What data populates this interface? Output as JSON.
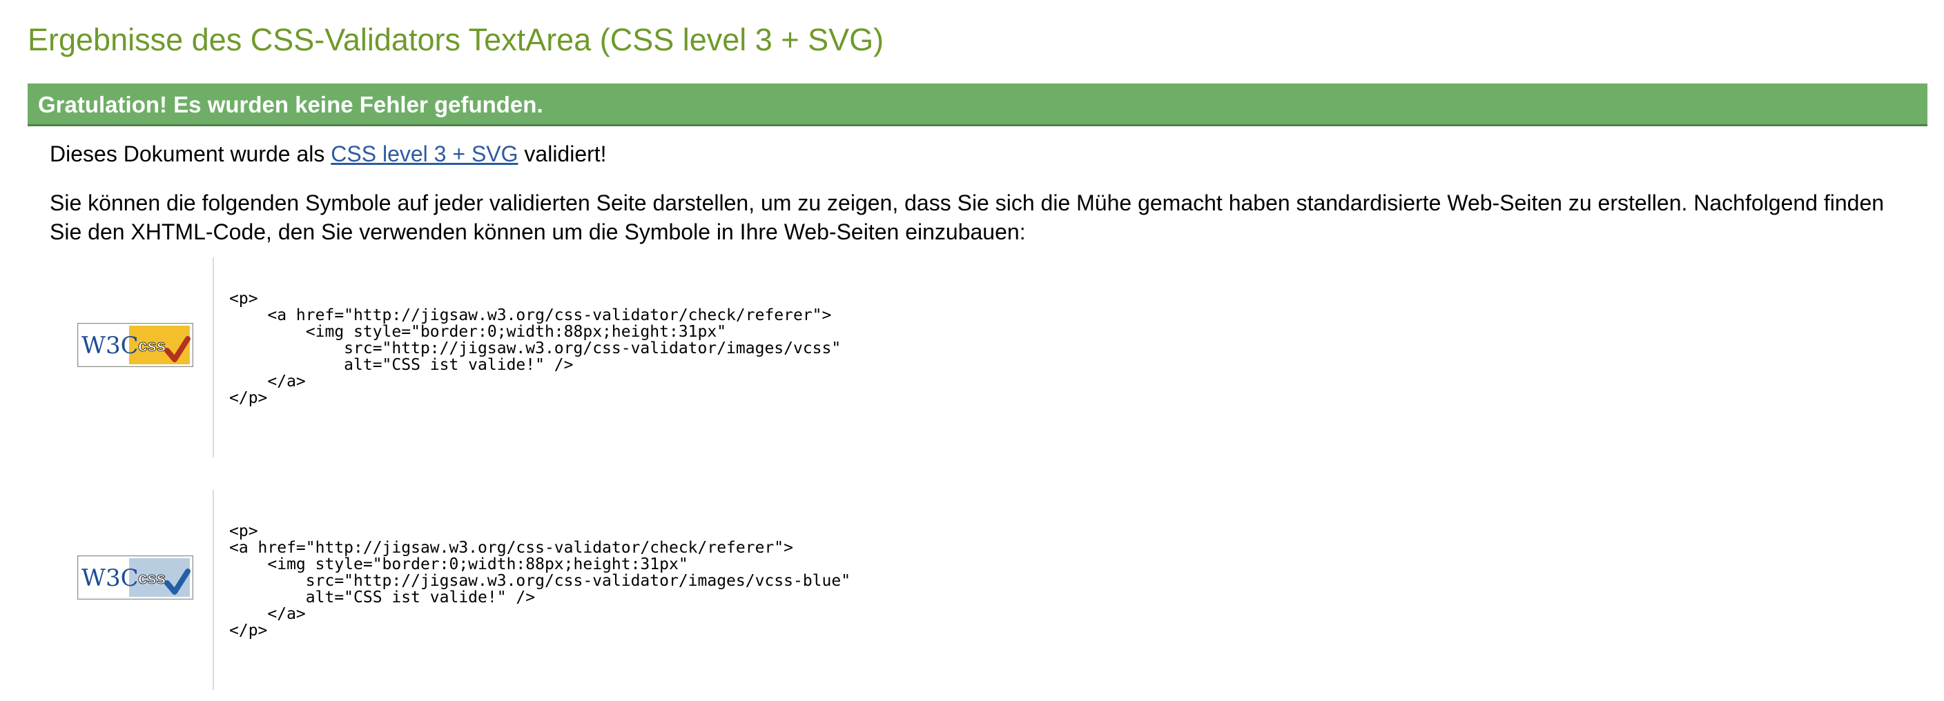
{
  "page": {
    "title": "Ergebnisse des CSS-Validators TextArea (CSS level 3 + SVG)"
  },
  "banner": {
    "text": "Gratulation! Es wurden keine Fehler gefunden."
  },
  "validation": {
    "prefix": "Dieses Dokument wurde als ",
    "link_text": "CSS level 3 + SVG",
    "suffix": " validiert!"
  },
  "intro": {
    "text": "Sie können die folgenden Symbole auf jeder validierten Seite darstellen, um zu zeigen, dass Sie sich die Mühe gemacht haben standardisierte Web-Seiten zu erstellen. Nachfolgend finden Sie den XHTML-Code, den Sie verwenden können um die Symbole in Ihre Web-Seiten einzubauen:"
  },
  "badges": [
    {
      "variant": "gold",
      "logo_text": "W3C",
      "label": "css",
      "colors": {
        "panel": "#f3c02c",
        "check": "#b5311f",
        "frame": "#8f8f8f",
        "logo": "#1d4c94"
      },
      "code": "<p>\n    <a href=\"http://jigsaw.w3.org/css-validator/check/referer\">\n        <img style=\"border:0;width:88px;height:31px\"\n            src=\"http://jigsaw.w3.org/css-validator/images/vcss\"\n            alt=\"CSS ist valide!\" />\n    </a>\n</p>"
    },
    {
      "variant": "blue",
      "logo_text": "W3C",
      "label": "css",
      "colors": {
        "panel": "#b8cde0",
        "check": "#245ea6",
        "frame": "#8f8f8f",
        "logo": "#1d4c94"
      },
      "code": "<p>\n<a href=\"http://jigsaw.w3.org/css-validator/check/referer\">\n    <img style=\"border:0;width:88px;height:31px\"\n        src=\"http://jigsaw.w3.org/css-validator/images/vcss-blue\"\n        alt=\"CSS ist valide!\" />\n    </a>\n</p>"
    }
  ],
  "colors": {
    "title": "#6f9a2b",
    "banner_background": "#6fae67",
    "banner_text": "#ffffff",
    "link": "#2c5aa0",
    "divider": "#d9d9d9"
  }
}
